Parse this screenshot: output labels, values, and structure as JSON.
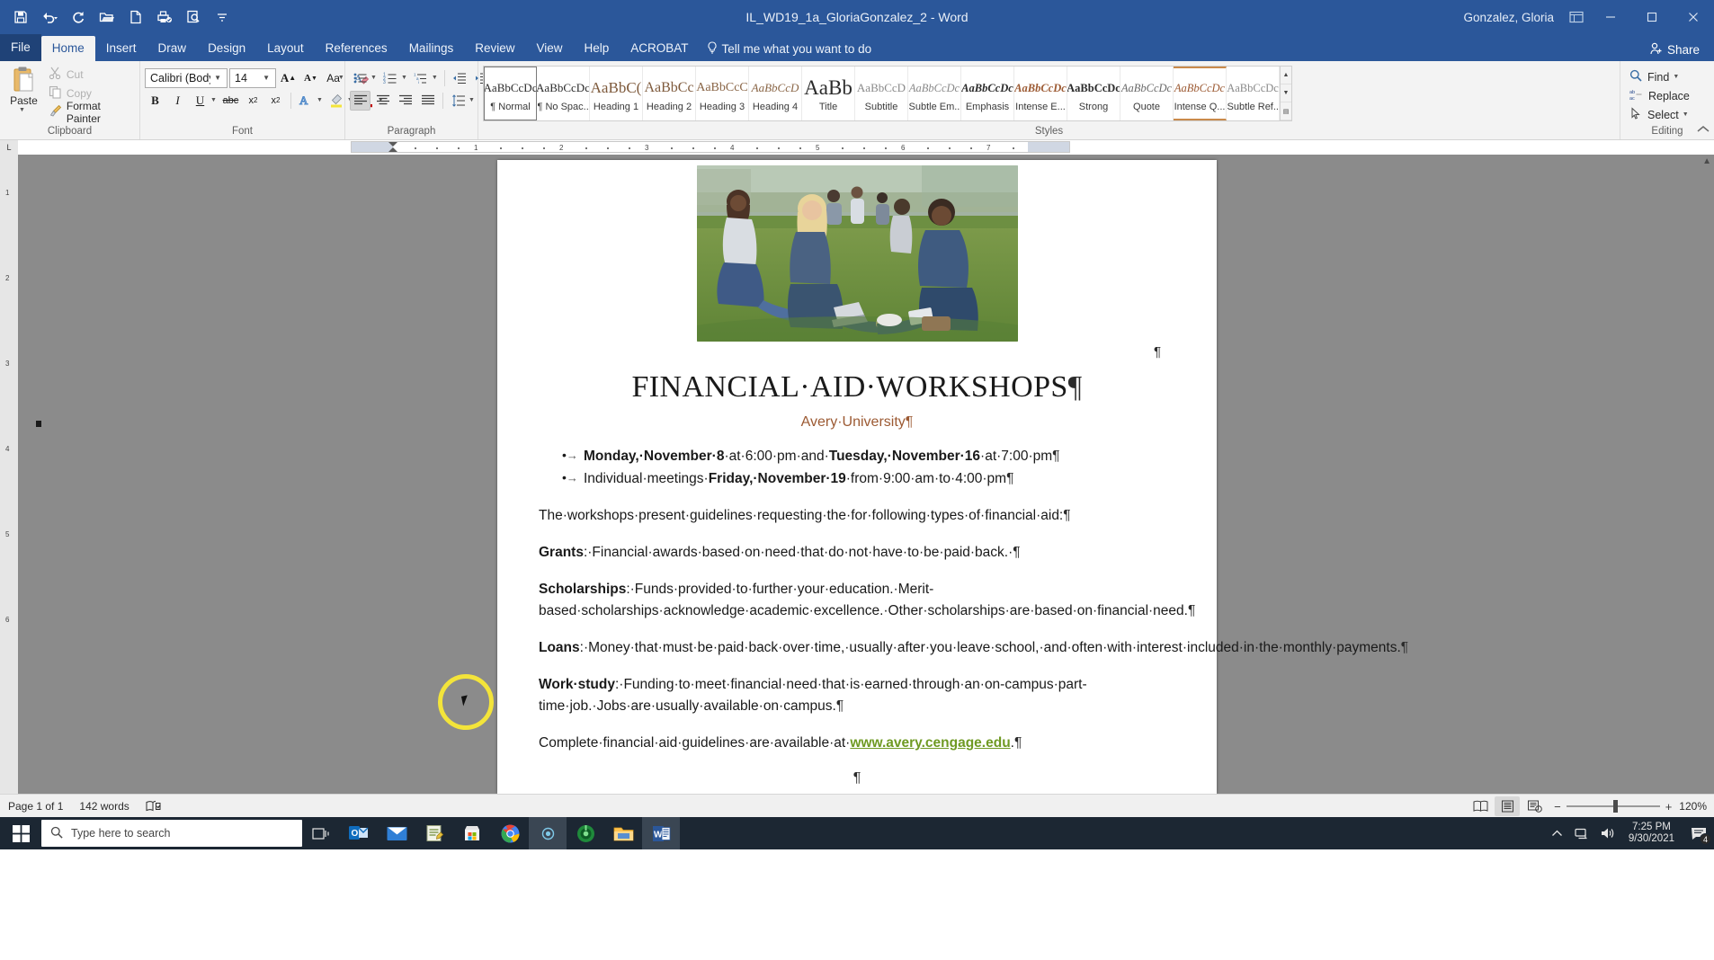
{
  "titlebar": {
    "document_title": "IL_WD19_1a_GloriaGonzalez_2  -  Word",
    "account_name": "Gonzalez, Gloria",
    "quick_access": [
      {
        "name": "save-icon",
        "label": "Save"
      },
      {
        "name": "undo-icon",
        "label": "Undo"
      },
      {
        "name": "redo-icon",
        "label": "Redo"
      },
      {
        "name": "open-icon",
        "label": "Open"
      },
      {
        "name": "new-icon",
        "label": "New"
      },
      {
        "name": "print-icon",
        "label": "Quick Print"
      },
      {
        "name": "print-preview-icon",
        "label": "Print Preview"
      },
      {
        "name": "customize-qat-icon",
        "label": "Customize Quick Access Toolbar"
      }
    ],
    "window_controls": [
      "ribbon-display-options",
      "minimize",
      "restore",
      "close"
    ]
  },
  "ribbon": {
    "tabs": [
      {
        "label": "File",
        "active": false
      },
      {
        "label": "Home",
        "active": true
      },
      {
        "label": "Insert",
        "active": false
      },
      {
        "label": "Draw",
        "active": false
      },
      {
        "label": "Design",
        "active": false
      },
      {
        "label": "Layout",
        "active": false
      },
      {
        "label": "References",
        "active": false
      },
      {
        "label": "Mailings",
        "active": false
      },
      {
        "label": "Review",
        "active": false
      },
      {
        "label": "View",
        "active": false
      },
      {
        "label": "Help",
        "active": false
      },
      {
        "label": "ACROBAT",
        "active": false
      }
    ],
    "tell_me": "Tell me what you want to do",
    "share": "Share",
    "groups": {
      "clipboard": {
        "label": "Clipboard",
        "paste": "Paste",
        "cut": "Cut",
        "copy": "Copy",
        "format_painter": "Format Painter"
      },
      "font": {
        "label": "Font",
        "font_name": "Calibri (Body)",
        "font_size": "14",
        "buttons": [
          "grow-font",
          "shrink-font",
          "change-case",
          "clear-formatting",
          "bold",
          "italic",
          "underline",
          "strikethrough",
          "subscript",
          "superscript",
          "text-effects",
          "text-highlight",
          "font-color"
        ]
      },
      "paragraph": {
        "label": "Paragraph",
        "buttons": [
          "bullets",
          "numbering",
          "multilevel-list",
          "decrease-indent",
          "increase-indent",
          "sort",
          "show-formatting-marks",
          "align-left",
          "align-center",
          "align-right",
          "justify",
          "line-spacing",
          "shading",
          "borders"
        ]
      },
      "styles": {
        "label": "Styles",
        "items": [
          {
            "preview": "AaBbCcDc",
            "name": "¶ Normal",
            "selected": true
          },
          {
            "preview": "AaBbCcDc",
            "name": "¶ No Spac...",
            "selected": false
          },
          {
            "preview": "AaBbC(",
            "name": "Heading 1",
            "selected": false
          },
          {
            "preview": "AaBbCc",
            "name": "Heading 2",
            "selected": false
          },
          {
            "preview": "AaBbCcC",
            "name": "Heading 3",
            "selected": false
          },
          {
            "preview": "AaBbCcD",
            "name": "Heading 4",
            "selected": false
          },
          {
            "preview": "AaBbCcDc",
            "name": "Title",
            "selected": false
          },
          {
            "preview": "AaBb",
            "name": "Title",
            "selected": false
          },
          {
            "preview": "AaBbCcD",
            "name": "Subtitle",
            "selected": false
          },
          {
            "preview": "AaBbCcDc",
            "name": "Subtle Em...",
            "selected": false
          },
          {
            "preview": "AaBbCcDc",
            "name": "Emphasis",
            "selected": false
          },
          {
            "preview": "AaBbCcDc",
            "name": "Intense E...",
            "selected": false
          },
          {
            "preview": "AaBbCcDc",
            "name": "Strong",
            "selected": false
          },
          {
            "preview": "AaBbCcDc",
            "name": "Quote",
            "selected": false
          },
          {
            "preview": "AaBbCcDc",
            "name": "Intense Q...",
            "selected": false
          },
          {
            "preview": "AaBbCcDc",
            "name": "Subtle Ref...",
            "selected": false
          }
        ]
      },
      "editing": {
        "label": "Editing",
        "find": "Find",
        "replace": "Replace",
        "select": "Select"
      }
    }
  },
  "ruler": {
    "h_ticks": [
      "1",
      "2",
      "3",
      "4",
      "5",
      "6",
      "7"
    ],
    "v_ticks": [
      "1",
      "2",
      "3",
      "4",
      "5",
      "6"
    ]
  },
  "document": {
    "photo_alt": "students-on-campus-lawn-photo",
    "title": "FINANCIAL·AID·WORKSHOPS",
    "subtitle": "Avery·University",
    "bullets": [
      {
        "pre": "",
        "bold1": "Monday,·November·8",
        "mid": "·at·6:00·pm·and·",
        "bold2": "Tuesday,·November·16",
        "post": "·at·7:00·pm"
      },
      {
        "pre": "Individual·meetings·",
        "bold1": "Friday,·November·19",
        "mid": "·from·9:00·am·to·4:00·pm",
        "bold2": "",
        "post": ""
      }
    ],
    "paragraphs": [
      {
        "bold": "",
        "text": "The·workshops·present·guidelines·requesting·the·for·following·types·of·financial·aid:"
      },
      {
        "bold": "Grants",
        "text": ":·Financial·awards·based·on·need·that·do·not·have·to·be·paid·back.·"
      },
      {
        "bold": "Scholarships",
        "text": ":·Funds·provided·to·further·your·education.·Merit-based·scholarships·acknowledge·academic·excellence.·Other·scholarships·are·based·on·financial·need."
      },
      {
        "bold": "Loans",
        "text": ":·Money·that·must·be·paid·back·over·time,·usually·after·you·leave·school,·and·often·with·interest·included·in·the·monthly·payments."
      },
      {
        "bold": "Work·study",
        "text": ":·Funding·to·meet·financial·need·that·is·earned·through·an·on-campus·part-time·job.·Jobs·are·usually·available·on·campus."
      }
    ],
    "final_paragraph": {
      "lead": "Complete·financial·aid·guidelines·are·available·at·",
      "link": "www.avery.cengage.edu",
      "tail": "."
    },
    "pilcrow": "¶",
    "colors": {
      "subtitle": "#9c5a33",
      "hyperlink": "#6f9a23",
      "highlight_circle": "#f3e43a"
    }
  },
  "statusbar": {
    "page": "Page 1 of 1",
    "words": "142 words",
    "proofing_icon": "proofing-errors-icon",
    "views": [
      {
        "name": "read-mode-icon",
        "active": false
      },
      {
        "name": "print-layout-icon",
        "active": true
      },
      {
        "name": "web-layout-icon",
        "active": false
      }
    ],
    "zoom_out": "−",
    "zoom_in": "+",
    "zoom_level": "120%"
  },
  "taskbar": {
    "search_placeholder": "Type here to search",
    "items": [
      {
        "name": "task-view-icon"
      },
      {
        "name": "outlook-icon"
      },
      {
        "name": "mail-icon"
      },
      {
        "name": "notepad-icon"
      },
      {
        "name": "microsoft-store-icon"
      },
      {
        "name": "chrome-icon"
      },
      {
        "name": "zoom-icon",
        "running": true
      },
      {
        "name": "camtasia-icon"
      },
      {
        "name": "file-explorer-icon"
      },
      {
        "name": "word-icon",
        "running": true
      }
    ],
    "tray": {
      "show_hidden": "show-hidden-icons-icon",
      "network": "network-icon",
      "volume": "volume-icon",
      "time": "7:25 PM",
      "date": "9/30/2021",
      "notification_count": "4"
    }
  }
}
